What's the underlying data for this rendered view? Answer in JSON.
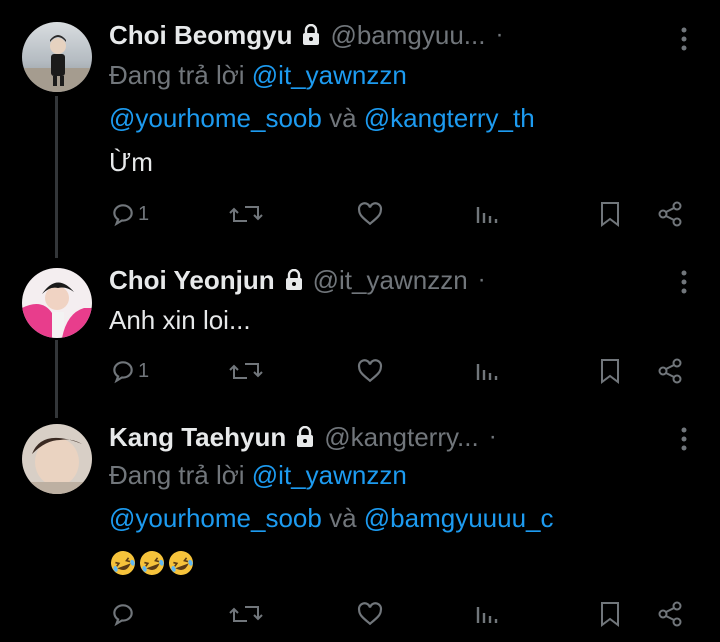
{
  "tweets": [
    {
      "name": "Choi Beomgyu",
      "handle": "@bamgyuu...",
      "separator": "·",
      "reply_prefix": "Đang trả lời ",
      "reply_user1": "@it_yawnzzn",
      "reply_user2": "@yourhome_soob",
      "reply_and": " và ",
      "reply_user3": "@kangterry_th",
      "text": "Ừm",
      "reply_count": "1"
    },
    {
      "name": "Choi Yeonjun",
      "handle": "@it_yawnzzn",
      "separator": "·",
      "text": "Anh xin loi...",
      "reply_count": "1"
    },
    {
      "name": "Kang Taehyun",
      "handle": "@kangterry...",
      "separator": "·",
      "reply_prefix": "Đang trả lời ",
      "reply_user1": "@it_yawnzzn",
      "reply_user2": "@yourhome_soob",
      "reply_and": " và ",
      "reply_user3": "@bamgyuuuu_c",
      "text_emoji": "rolling-on-floor-laughing x3",
      "reply_count": ""
    }
  ],
  "colors": {
    "background": "#000000",
    "text": "#e7e9ea",
    "muted": "#71767b",
    "link": "#1d9bf0",
    "emoji": "#f6c33b"
  },
  "icons": [
    "lock-icon",
    "more-icon",
    "reply-icon",
    "retweet-icon",
    "like-icon",
    "views-icon",
    "bookmark-icon",
    "share-icon"
  ]
}
